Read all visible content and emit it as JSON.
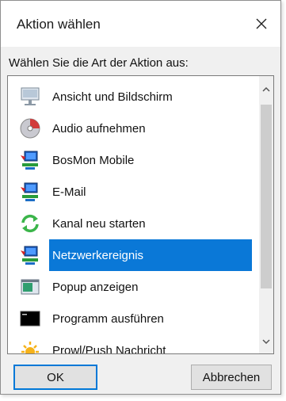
{
  "dialog": {
    "title": "Aktion wählen",
    "prompt": "Wählen Sie die Art der Aktion aus:",
    "close_icon": "close-icon"
  },
  "actions": {
    "items": [
      {
        "label": "Ansicht und Bildschirm",
        "icon": "monitor-icon",
        "selected": false
      },
      {
        "label": "Audio aufnehmen",
        "icon": "cd-audio-icon",
        "selected": false
      },
      {
        "label": "BosMon Mobile",
        "icon": "network-computer-icon",
        "selected": false
      },
      {
        "label": "E-Mail",
        "icon": "network-computer-icon",
        "selected": false
      },
      {
        "label": "Kanal neu starten",
        "icon": "refresh-arrows-icon",
        "selected": false
      },
      {
        "label": "Netzwerkereignis",
        "icon": "network-computer-icon",
        "selected": true
      },
      {
        "label": "Popup anzeigen",
        "icon": "popup-window-icon",
        "selected": false
      },
      {
        "label": "Programm ausführen",
        "icon": "console-icon",
        "selected": false
      },
      {
        "label": "Prowl/Push Nachricht",
        "icon": "sun-icon",
        "selected": false
      }
    ]
  },
  "buttons": {
    "ok": "OK",
    "cancel": "Abbrechen"
  },
  "colors": {
    "selection": "#0a78d7",
    "default_button_border": "#0078d7"
  }
}
